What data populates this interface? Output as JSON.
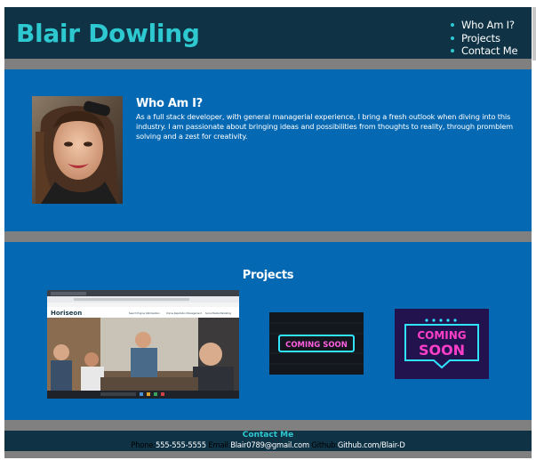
{
  "header": {
    "brand": "Blair Dowling",
    "nav": [
      "Who Am I?",
      "Projects",
      "Contact Me"
    ]
  },
  "about": {
    "title": "Who Am I?",
    "text": "As a full stack developer, with general managerial experience, I bring a fresh outlook when diving into this industry. I am passionate about bringing ideas and possibilities from thoughts to reality, through promblem solving and a zest for creativity."
  },
  "projects": {
    "title": "Projects",
    "items": [
      {
        "logo": "Horiseon",
        "hero_links": [
          "Search Engine Optimization",
          "Online Reputation Management",
          "Social Media Marketing"
        ]
      },
      {
        "sign_text": "COMING SOON"
      },
      {
        "sign_line1": "COMING",
        "sign_line2": "SOON"
      }
    ]
  },
  "footer": {
    "title": "Contact Me",
    "phone_label": "Phone:",
    "phone": "555-555-5555",
    "email_label": "Email:",
    "email": "Blair0789@gmail.com",
    "github_label": "Github:",
    "github": "Github.com/Blair-D"
  },
  "colors": {
    "header_bg": "#0f3245",
    "accent": "#2ec9d0",
    "section_bg": "#0468b2",
    "divider": "#808080"
  }
}
